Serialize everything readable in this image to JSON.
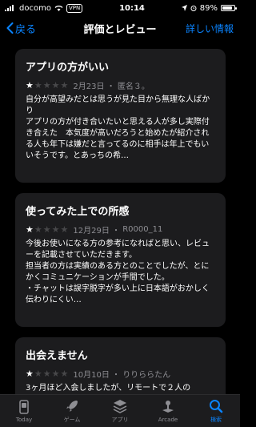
{
  "status": {
    "carrier": "docomo",
    "vpn": "VPN",
    "time": "10:14",
    "battery": "89%",
    "battery_level": 0.89
  },
  "nav": {
    "back_label": "戻る",
    "title": "評価とレビュー",
    "right_label": "詳しい情報"
  },
  "reviews": [
    {
      "title": "アプリの方がいい",
      "rating": 1,
      "date": "2月23日",
      "author": "匿名３。",
      "lines": [
        "自分が高望みだとは思うが見た目から無理な人ばかり",
        "アプリの方が付き合いたいと思える人が多し実際付き合えた　本気度が高いだろうと始めたが紹介される人も年下は嫌だと言ってるのに相手は年上でもいいそうです。とあっちの希…"
      ]
    },
    {
      "title": "使ってみた上での所感",
      "rating": 1,
      "date": "12月29日",
      "author": "R0000_11",
      "lines": [
        "今後お使いになる方の参考になればと思い、レビューを記載させていただきます。",
        "担当者の方は実績のある方とのことでしたが、とにかくコミュニケーションが手間でした。",
        "・チャットは誤字脱字が多い上に日本語がおかしく伝わりにくい…"
      ]
    },
    {
      "title": "出会えません",
      "rating": 1,
      "date": "10月10日",
      "author": "りりららたん",
      "lines": [
        "3ヶ月ほど入会しましたが、リモートで２人の"
      ]
    }
  ],
  "tabs": [
    {
      "label": "Today",
      "icon": "today-icon",
      "active": false
    },
    {
      "label": "ゲーム",
      "icon": "rocket-icon",
      "active": false
    },
    {
      "label": "アプリ",
      "icon": "layers-icon",
      "active": false
    },
    {
      "label": "Arcade",
      "icon": "joystick-icon",
      "active": false
    },
    {
      "label": "検索",
      "icon": "search-icon",
      "active": true
    }
  ],
  "colors": {
    "accent": "#0a84ff",
    "card": "#1c1c1e",
    "background": "#000000",
    "secondary_text": "#8e8e93"
  }
}
